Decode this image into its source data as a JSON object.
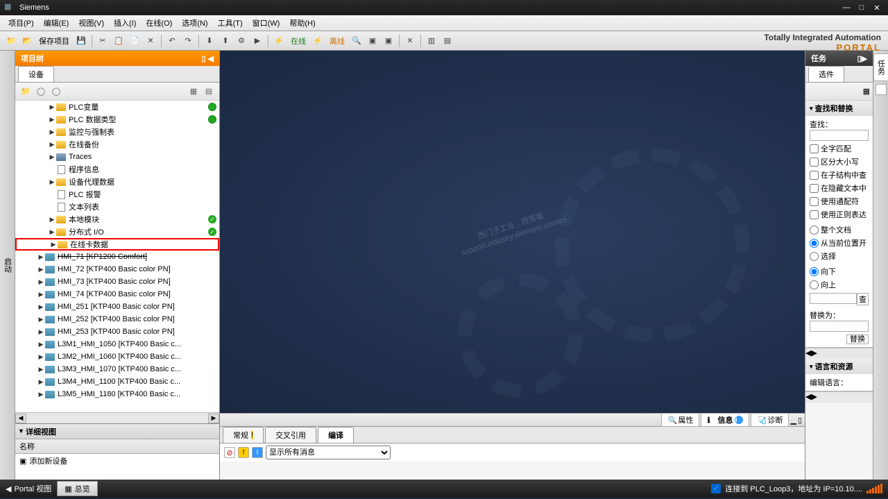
{
  "title": "Siemens",
  "menu": [
    "项目(P)",
    "编辑(E)",
    "视图(V)",
    "插入(I)",
    "在线(O)",
    "选项(N)",
    "工具(T)",
    "窗口(W)",
    "帮助(H)"
  ],
  "toolbar": {
    "save": "保存项目",
    "online": "在线",
    "offline": "离线"
  },
  "brand": {
    "line1": "Totally Integrated Automation",
    "line2": "PORTAL"
  },
  "leftstrip": "启动",
  "projtree": {
    "title": "项目树",
    "tab": "设备",
    "items": [
      {
        "indent": 3,
        "arrow": "▶",
        "icon": "folder-y",
        "label": "PLC变量",
        "status": "green"
      },
      {
        "indent": 3,
        "arrow": "▶",
        "icon": "folder-y",
        "label": "PLC 数据类型",
        "status": "green"
      },
      {
        "indent": 3,
        "arrow": "▶",
        "icon": "folder-y",
        "label": "监控与强制表"
      },
      {
        "indent": 3,
        "arrow": "▶",
        "icon": "folder-y",
        "label": "在线备份"
      },
      {
        "indent": 3,
        "arrow": "▶",
        "icon": "folder-b",
        "label": "Traces"
      },
      {
        "indent": 3,
        "arrow": "",
        "icon": "page-i",
        "label": "程序信息"
      },
      {
        "indent": 3,
        "arrow": "▶",
        "icon": "folder-y",
        "label": "设备代理数据"
      },
      {
        "indent": 3,
        "arrow": "",
        "icon": "page-i",
        "label": "PLC 报警"
      },
      {
        "indent": 3,
        "arrow": "",
        "icon": "page-i",
        "label": "文本列表"
      },
      {
        "indent": 3,
        "arrow": "▶",
        "icon": "folder-y",
        "label": "本地模块",
        "status": "check"
      },
      {
        "indent": 3,
        "arrow": "▶",
        "icon": "folder-y",
        "label": "分布式 I/O",
        "status": "check"
      },
      {
        "indent": 3,
        "arrow": "▶",
        "icon": "folder-y",
        "label": "在线卡数据",
        "hl": true
      },
      {
        "indent": 2,
        "arrow": "▶",
        "icon": "hmi-i",
        "label": "HMI_71 [KP1200 Comfort]",
        "strike": true
      },
      {
        "indent": 2,
        "arrow": "▶",
        "icon": "hmi-i",
        "label": "HMI_72 [KTP400 Basic color PN]"
      },
      {
        "indent": 2,
        "arrow": "▶",
        "icon": "hmi-i",
        "label": "HMI_73 [KTP400 Basic color PN]"
      },
      {
        "indent": 2,
        "arrow": "▶",
        "icon": "hmi-i",
        "label": "HMI_74 [KTP400 Basic color PN]"
      },
      {
        "indent": 2,
        "arrow": "▶",
        "icon": "hmi-i",
        "label": "HMI_251 [KTP400 Basic color PN]"
      },
      {
        "indent": 2,
        "arrow": "▶",
        "icon": "hmi-i",
        "label": "HMI_252 [KTP400 Basic color PN]"
      },
      {
        "indent": 2,
        "arrow": "▶",
        "icon": "hmi-i",
        "label": "HMI_253 [KTP400 Basic color PN]"
      },
      {
        "indent": 2,
        "arrow": "▶",
        "icon": "hmi-i",
        "label": "L3M1_HMI_1050 [KTP400 Basic c..."
      },
      {
        "indent": 2,
        "arrow": "▶",
        "icon": "hmi-i",
        "label": "L3M2_HMI_1060 [KTP400 Basic c..."
      },
      {
        "indent": 2,
        "arrow": "▶",
        "icon": "hmi-i",
        "label": "L3M3_HMI_1070 [KTP400 Basic c..."
      },
      {
        "indent": 2,
        "arrow": "▶",
        "icon": "hmi-i",
        "label": "L3M4_HMI_1100 [KTP400 Basic c..."
      },
      {
        "indent": 2,
        "arrow": "▶",
        "icon": "hmi-i",
        "label": "L3M5_HMI_1180 [KTP400 Basic c..."
      }
    ]
  },
  "detail": {
    "title": "详细视图",
    "col": "名称",
    "row": "添加新设备"
  },
  "infotabs": {
    "prop": "属性",
    "info": "信息",
    "diag": "诊断"
  },
  "compile": {
    "tabs": [
      "常规",
      "交叉引用",
      "编译"
    ],
    "filter": "显示所有消息"
  },
  "task": {
    "title": "任务",
    "options": "选件",
    "find": {
      "title": "查找和替换",
      "findlabel": "查找：",
      "replacelabel": "替换为：",
      "chk": [
        "全字匹配",
        "区分大小写",
        "在子结构中查",
        "在隐藏文本中",
        "使用通配符",
        "使用正则表达"
      ],
      "radio": [
        "整个文档",
        "从当前位置开",
        "选择"
      ],
      "chk2": [
        "向下",
        "向上"
      ],
      "findbtn": "查",
      "repbtn": "替换"
    },
    "lang": {
      "title": "语言和资源",
      "label": "编辑语言："
    }
  },
  "rightstrip": "任务",
  "watermark": {
    "l1": "西门子工业　找答案",
    "l2": "support.industry.siemens.com/cs"
  },
  "status": {
    "portal": "Portal 视图",
    "overview": "总览",
    "conn": "连接到 PLC_Loop3，地址为 IP=10.10...."
  }
}
